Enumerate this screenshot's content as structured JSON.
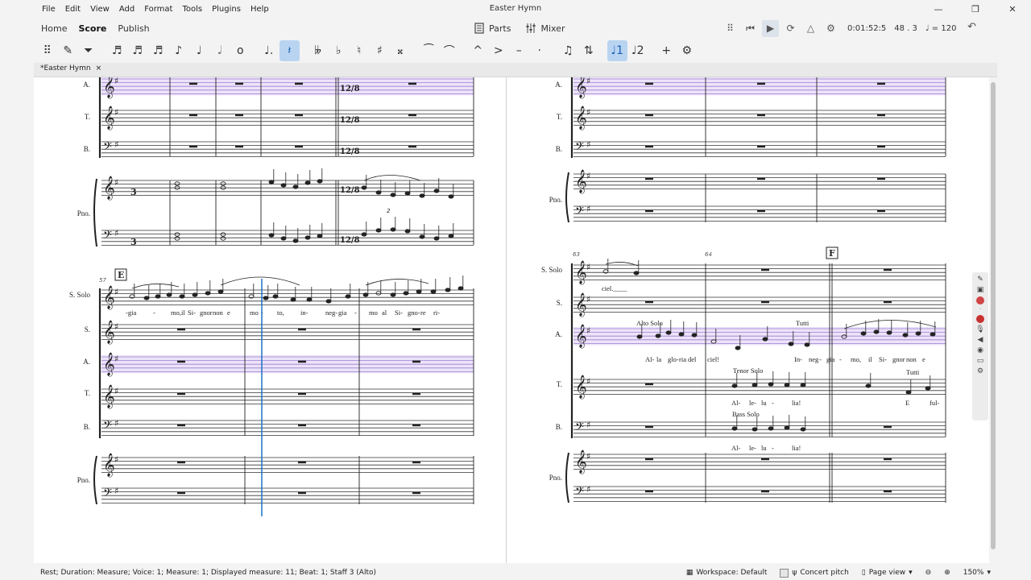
{
  "window": {
    "title": "Easter Hymn",
    "menu": [
      "File",
      "Edit",
      "View",
      "Add",
      "Format",
      "Tools",
      "Plugins",
      "Help"
    ],
    "controls": {
      "minimize": "—",
      "maximize": "❐",
      "close": "✕"
    }
  },
  "tabs": {
    "items": [
      "Home",
      "Score",
      "Publish"
    ],
    "active": "Score",
    "parts_label": "Parts",
    "mixer_label": "Mixer"
  },
  "playback": {
    "time": "0:01:52:5",
    "measure_beat": "48 . 3",
    "tempo": "♩ = 120"
  },
  "toolbar": {
    "buttons": [
      "drag",
      "pencil",
      "default",
      "64th",
      "32nd",
      "16th",
      "8th",
      "quarter",
      "half",
      "whole",
      "augmentation-dot",
      "rest",
      "double-flat",
      "flat",
      "natural",
      "sharp",
      "double-sharp",
      "tie",
      "slur",
      "marcato",
      "accent",
      "tenuto",
      "staccato",
      "tuplet",
      "flip",
      "voice1",
      "voice2",
      "add",
      "customize"
    ],
    "selected": [
      "rest",
      "voice1"
    ]
  },
  "document_tab": {
    "label": "*Easter Hymn",
    "close": "×"
  },
  "score": {
    "left_page": {
      "system1_staves": [
        "A.",
        "T.",
        "B.",
        "Pno."
      ],
      "system2_staves": [
        "S. Solo",
        "S.",
        "A.",
        "T.",
        "B.",
        "Pno."
      ],
      "rehearsal_mark": "E",
      "measure_number": "57",
      "lyrics_solo": [
        "-gia",
        "-",
        "mo,il",
        "Si-",
        "gnor",
        "non",
        "e",
        "mo",
        "-",
        "to,",
        "in-",
        "neg-",
        "gia",
        "-",
        "mo",
        "al",
        "Si-",
        "gno-",
        "re",
        "ri-"
      ],
      "time_sig": "12/8",
      "tuplet": "2"
    },
    "right_page": {
      "system1_staves": [
        "A.",
        "T.",
        "B.",
        "Pno."
      ],
      "system2_staves": [
        "S. Solo",
        "S.",
        "A.",
        "T.",
        "B.",
        "Pno."
      ],
      "rehearsal_mark": "F",
      "measure_numbers": [
        "63",
        "64"
      ],
      "annotations": {
        "alto_solo": "Alto Solo",
        "tutti": "Tutti",
        "tenor_solo": "Tenor Solo",
        "tutti2": "Tutti",
        "bass_solo": "Bass Solo"
      },
      "lyrics": {
        "solo": "ciel.____",
        "alto": [
          "Al-",
          "la",
          "glo-",
          "ria",
          "del",
          "ciel!",
          "In-",
          "neg",
          "-",
          "gia",
          "-",
          "mo,",
          "il",
          "Si-",
          "gnor",
          "non",
          "e"
        ],
        "tenor": [
          "Al-",
          "le-",
          "lu",
          "-",
          "lia!",
          "E",
          "ful-"
        ],
        "bass": [
          "Al-",
          "le-",
          "lu",
          "-",
          "lia!"
        ]
      }
    }
  },
  "statusbar": {
    "text": "Rest; Duration: Measure; Voice: 1; Measure: 1; Displayed measure: 11; Beat: 1; Staff 3 (Alto)",
    "workspace": "Workspace: Default",
    "concert_pitch": "Concert pitch",
    "page_view": "Page view",
    "zoom": "150%"
  },
  "colors": {
    "accent": "#1a73c8",
    "selection": "#b9d4f1",
    "staff_highlight": "#c9b6e8"
  }
}
